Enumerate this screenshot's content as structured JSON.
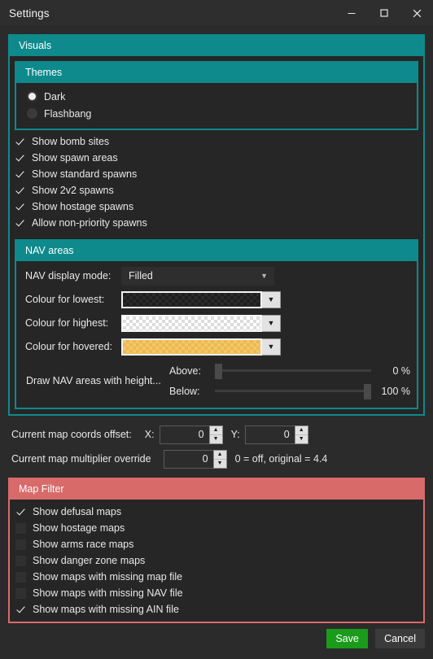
{
  "window": {
    "title": "Settings",
    "controls": [
      {
        "name": "minimize",
        "icon": "minimize-icon"
      },
      {
        "name": "maximize",
        "icon": "maximize-icon"
      },
      {
        "name": "close",
        "icon": "close-icon"
      }
    ]
  },
  "visuals": {
    "title": "Visuals",
    "themes": {
      "title": "Themes",
      "options": [
        {
          "label": "Dark",
          "selected": true
        },
        {
          "label": "Flashbang",
          "selected": false
        }
      ]
    },
    "checkboxes": [
      {
        "label": "Show bomb sites",
        "checked": true
      },
      {
        "label": "Show spawn areas",
        "checked": true
      },
      {
        "label": "Show standard spawns",
        "checked": true
      },
      {
        "label": "Show 2v2 spawns",
        "checked": true
      },
      {
        "label": "Show hostage spawns",
        "checked": true
      },
      {
        "label": "Allow non-priority spawns",
        "checked": true
      }
    ],
    "nav_areas": {
      "title": "NAV areas",
      "display_mode": {
        "label": "NAV display mode:",
        "value": "Filled"
      },
      "colours": [
        {
          "label": "Colour for lowest:",
          "swatch": "dark",
          "hex": "#1e1e1e"
        },
        {
          "label": "Colour for highest:",
          "swatch": "white",
          "hex": "#ffffff"
        },
        {
          "label": "Colour for hovered:",
          "swatch": "amber",
          "hex": "#f3c76a"
        }
      ],
      "height_filter": {
        "description": "Draw NAV areas with height...",
        "above": {
          "label": "Above:",
          "value": "0 %",
          "percent": 0
        },
        "below": {
          "label": "Below:",
          "value": "100 %",
          "percent": 100
        }
      }
    }
  },
  "offsets": {
    "coords_label": "Current map coords offset:",
    "x_label": "X:",
    "x_value": "0",
    "y_label": "Y:",
    "y_value": "0",
    "multiplier_label": "Current map multiplier override",
    "multiplier_value": "0",
    "multiplier_note": "0 = off, original =  4.4"
  },
  "map_filter": {
    "title": "Map Filter",
    "checkboxes": [
      {
        "label": "Show defusal maps",
        "checked": true
      },
      {
        "label": "Show hostage maps",
        "checked": false
      },
      {
        "label": "Show arms race maps",
        "checked": false
      },
      {
        "label": "Show danger zone maps",
        "checked": false
      },
      {
        "label": "Show maps with missing map file",
        "checked": false
      },
      {
        "label": "Show maps with missing NAV file",
        "checked": false
      },
      {
        "label": "Show maps with missing AIN file",
        "checked": true
      }
    ]
  },
  "footer": {
    "save_label": "Save",
    "cancel_label": "Cancel"
  },
  "colors": {
    "teal": "#0e8a8c",
    "red": "#d96a6a",
    "save_green": "#1a9b1a",
    "background": "#2b2b2b"
  }
}
